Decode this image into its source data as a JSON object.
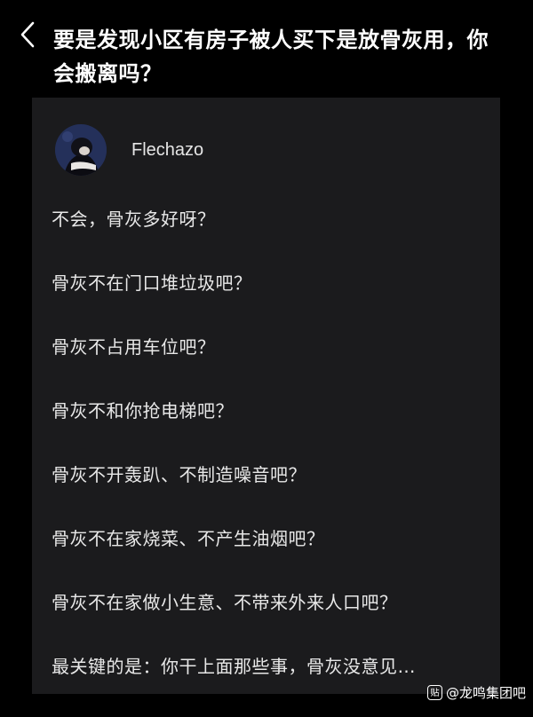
{
  "header": {
    "back_icon": "chevron-left-icon",
    "question": "要是发现小区有房子被人买下是放骨灰用，你会搬离吗？"
  },
  "answer": {
    "author": {
      "name": "Flechazo",
      "avatar": "avatar-image"
    },
    "lines": [
      "不会，骨灰多好呀？",
      "骨灰不在门口堆垃圾吧？",
      "骨灰不占用车位吧？",
      "骨灰不和你抢电梯吧？",
      "骨灰不开轰趴、不制造噪音吧？",
      "骨灰不在家烧菜、不产生油烟吧？",
      "骨灰不在家做小生意、不带来外来人口吧？",
      "最关键的是：你干上面那些事，骨灰没意见…"
    ]
  },
  "watermark": {
    "icon": "tieba-logo-icon",
    "text": "@龙鸣集团吧"
  },
  "colors": {
    "background": "#000000",
    "card": "#1b1b1d",
    "text": "#e8e8e8"
  }
}
